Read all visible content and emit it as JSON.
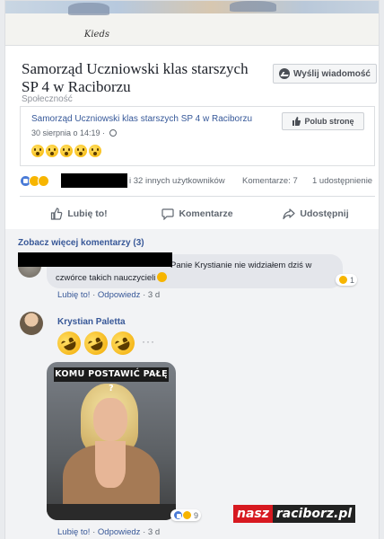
{
  "cover": {
    "signature": "Kieds"
  },
  "page": {
    "title": "Samorząd Uczniowski klas starszych SP 4 w Raciborzu",
    "category": "Społeczność",
    "message_button": "Wyślij wiadomość",
    "message_icon": "messenger-icon"
  },
  "shared_post": {
    "name": "Samorząd Uczniowski klas starszych SP 4 w Raciborzu",
    "date": "30 sierpnia o 14:19 ·",
    "like_page_button": "Polub stronę",
    "emoji_count": 5
  },
  "reactions": {
    "others": "i 32 innych użytkowników",
    "comments": "Komentarze: 7",
    "shares": "1 udostępnienie"
  },
  "actions": {
    "like": "Lubię to!",
    "comment": "Komentarze",
    "share": "Udostępnij"
  },
  "comments": {
    "more": "Zobacz więcej komentarzy (3)",
    "first": {
      "text_line1": "Panie Krystianie nie widziałem dziś w",
      "text_line2": "czwórce takich nauczycieli",
      "reaction_count": "1",
      "like_link": "Lubię to!",
      "reply_link": "Odpowiedz",
      "age": "3 d"
    },
    "second": {
      "author": "Krystian Paletta",
      "image_caption": "KOMU POSTAWIĆ PAŁĘ ?",
      "reaction_count": "9",
      "like_link": "Lubię to!",
      "reply_link": "Odpowiedz",
      "age": "3 d",
      "more": "···"
    }
  },
  "watermark": {
    "part1": "nasz",
    "part2": "raciborz.pl"
  },
  "colors": {
    "link": "#385898",
    "redaction": "#000000",
    "brand_red": "#d71920"
  }
}
